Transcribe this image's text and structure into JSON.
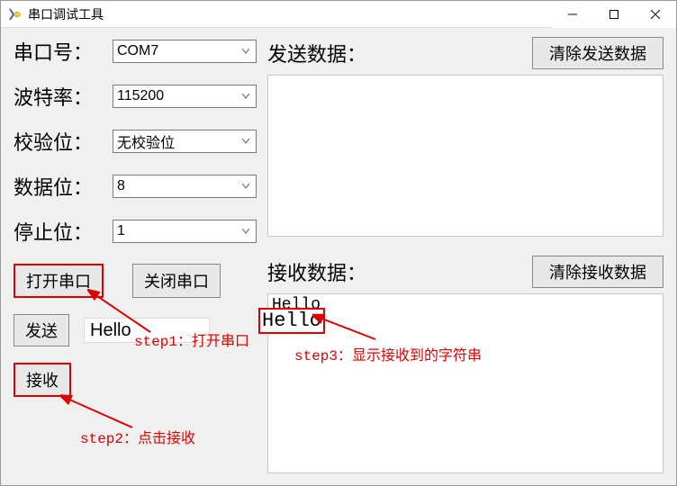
{
  "window": {
    "title": "串口调试工具"
  },
  "form": {
    "port_label": "串口号：",
    "port_value": "COM7",
    "baud_label": "波特率：",
    "baud_value": "115200",
    "parity_label": "校验位：",
    "parity_value": "无校验位",
    "databits_label": "数据位：",
    "databits_value": "8",
    "stopbits_label": "停止位：",
    "stopbits_value": "1"
  },
  "buttons": {
    "open": "打开串口",
    "close": "关闭串口",
    "send": "发送",
    "receive": "接收",
    "clear_send": "清除发送数据",
    "clear_recv": "清除接收数据"
  },
  "data_panels": {
    "send_label": "发送数据：",
    "send_value": "",
    "recv_label": "接收数据：",
    "recv_value": "Hello"
  },
  "inputs": {
    "send_text": "Hello"
  },
  "annotations": {
    "step1": "step1：打开串口",
    "step2": "step2：点击接收",
    "step3": "step3：显示接收到的字符串"
  }
}
